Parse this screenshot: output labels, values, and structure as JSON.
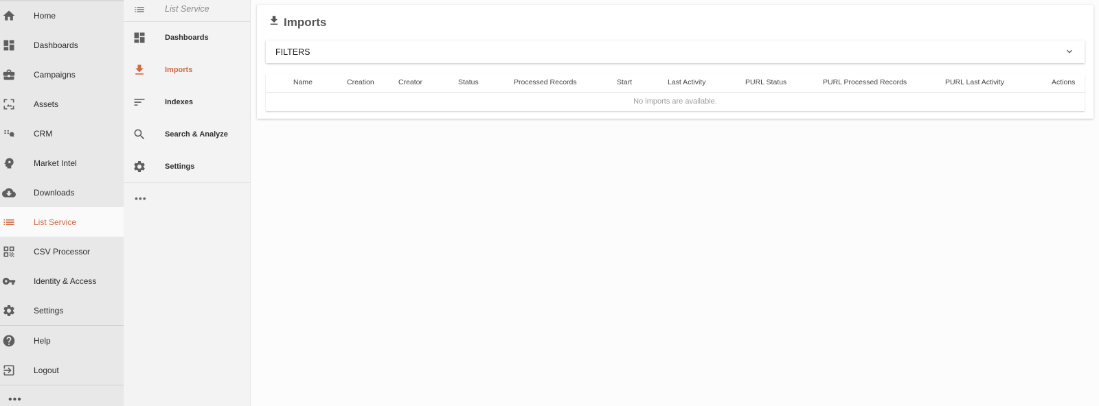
{
  "primary_nav": {
    "items": [
      {
        "label": "Home",
        "icon": "home-icon"
      },
      {
        "label": "Dashboards",
        "icon": "dashboard-icon"
      },
      {
        "label": "Campaigns",
        "icon": "briefcase-icon"
      },
      {
        "label": "Assets",
        "icon": "assets-icon"
      },
      {
        "label": "CRM",
        "icon": "crm-icon"
      },
      {
        "label": "Market Intel",
        "icon": "head-icon"
      },
      {
        "label": "Downloads",
        "icon": "cloud-download-icon"
      },
      {
        "label": "List Service",
        "icon": "list-icon",
        "active": true
      },
      {
        "label": "CSV Processor",
        "icon": "qr-icon"
      },
      {
        "label": "Identity & Access",
        "icon": "key-icon"
      },
      {
        "label": "Settings",
        "icon": "gear-icon"
      },
      {
        "label": "Help",
        "icon": "help-icon"
      },
      {
        "label": "Logout",
        "icon": "logout-icon"
      }
    ],
    "more": "•••"
  },
  "secondary_nav": {
    "title": "List Service",
    "items": [
      {
        "label": "Dashboards",
        "icon": "dashboard-icon"
      },
      {
        "label": "Imports",
        "icon": "download-icon",
        "active": true
      },
      {
        "label": "Indexes",
        "icon": "sort-icon"
      },
      {
        "label": "Search & Analyze",
        "icon": "search-icon"
      },
      {
        "label": "Settings",
        "icon": "gear-icon"
      }
    ],
    "more": "•••"
  },
  "main": {
    "title": "Imports",
    "filters_label": "FILTERS",
    "table": {
      "columns": [
        "Name",
        "Creation",
        "Creator",
        "Status",
        "Processed Records",
        "Start",
        "Last Activity",
        "PURL Status",
        "PURL Processed Records",
        "PURL Last Activity",
        "Actions"
      ],
      "empty_message": "No imports are available."
    }
  },
  "colors": {
    "accent": "#cf6a43",
    "primary_sidebar_bg": "#e8e8e8",
    "secondary_sidebar_bg": "#f3f3f3"
  }
}
